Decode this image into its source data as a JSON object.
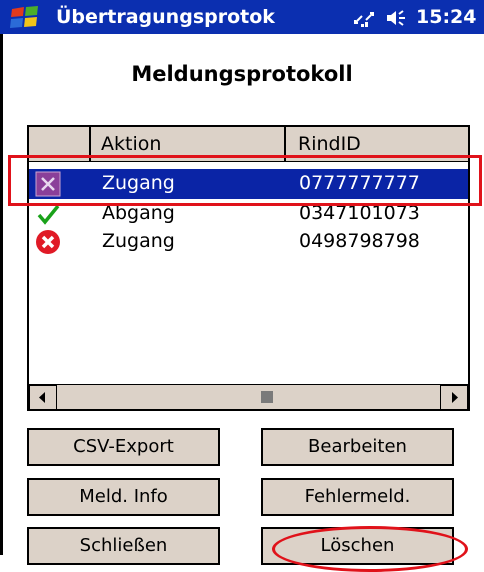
{
  "window": {
    "title": "Übertragungsprotok",
    "time": "15:24",
    "status_icons": [
      "connectivity-icon",
      "volume-icon"
    ],
    "logo_icon": "windows-flag-icon"
  },
  "dialog": {
    "heading": "Meldungsprotokoll"
  },
  "table": {
    "columns": [
      "Aktion",
      "RindID"
    ],
    "rows": [
      {
        "status": "pending",
        "status_icon": "purple-box-x-icon",
        "aktion": "Zugang",
        "rindid": "0777777777",
        "selected": true
      },
      {
        "status": "success",
        "status_icon": "green-check-icon",
        "aktion": "Abgang",
        "rindid": "0347101073",
        "selected": false
      },
      {
        "status": "error",
        "status_icon": "red-x-circle-icon",
        "aktion": "Zugang",
        "rindid": "0498798798",
        "selected": false
      }
    ]
  },
  "buttons": {
    "csv_export": "CSV-Export",
    "bearbeiten": "Bearbeiten",
    "meld_info": "Meld. Info",
    "fehlermeld": "Fehlermeld.",
    "schliessen": "Schließen",
    "loeschen": "Löschen"
  },
  "colors": {
    "titlebar": "#0b2fb0",
    "selection": "#0a24a6",
    "button_face": "#dcd2c8",
    "annotation_red": "#e0121a"
  }
}
